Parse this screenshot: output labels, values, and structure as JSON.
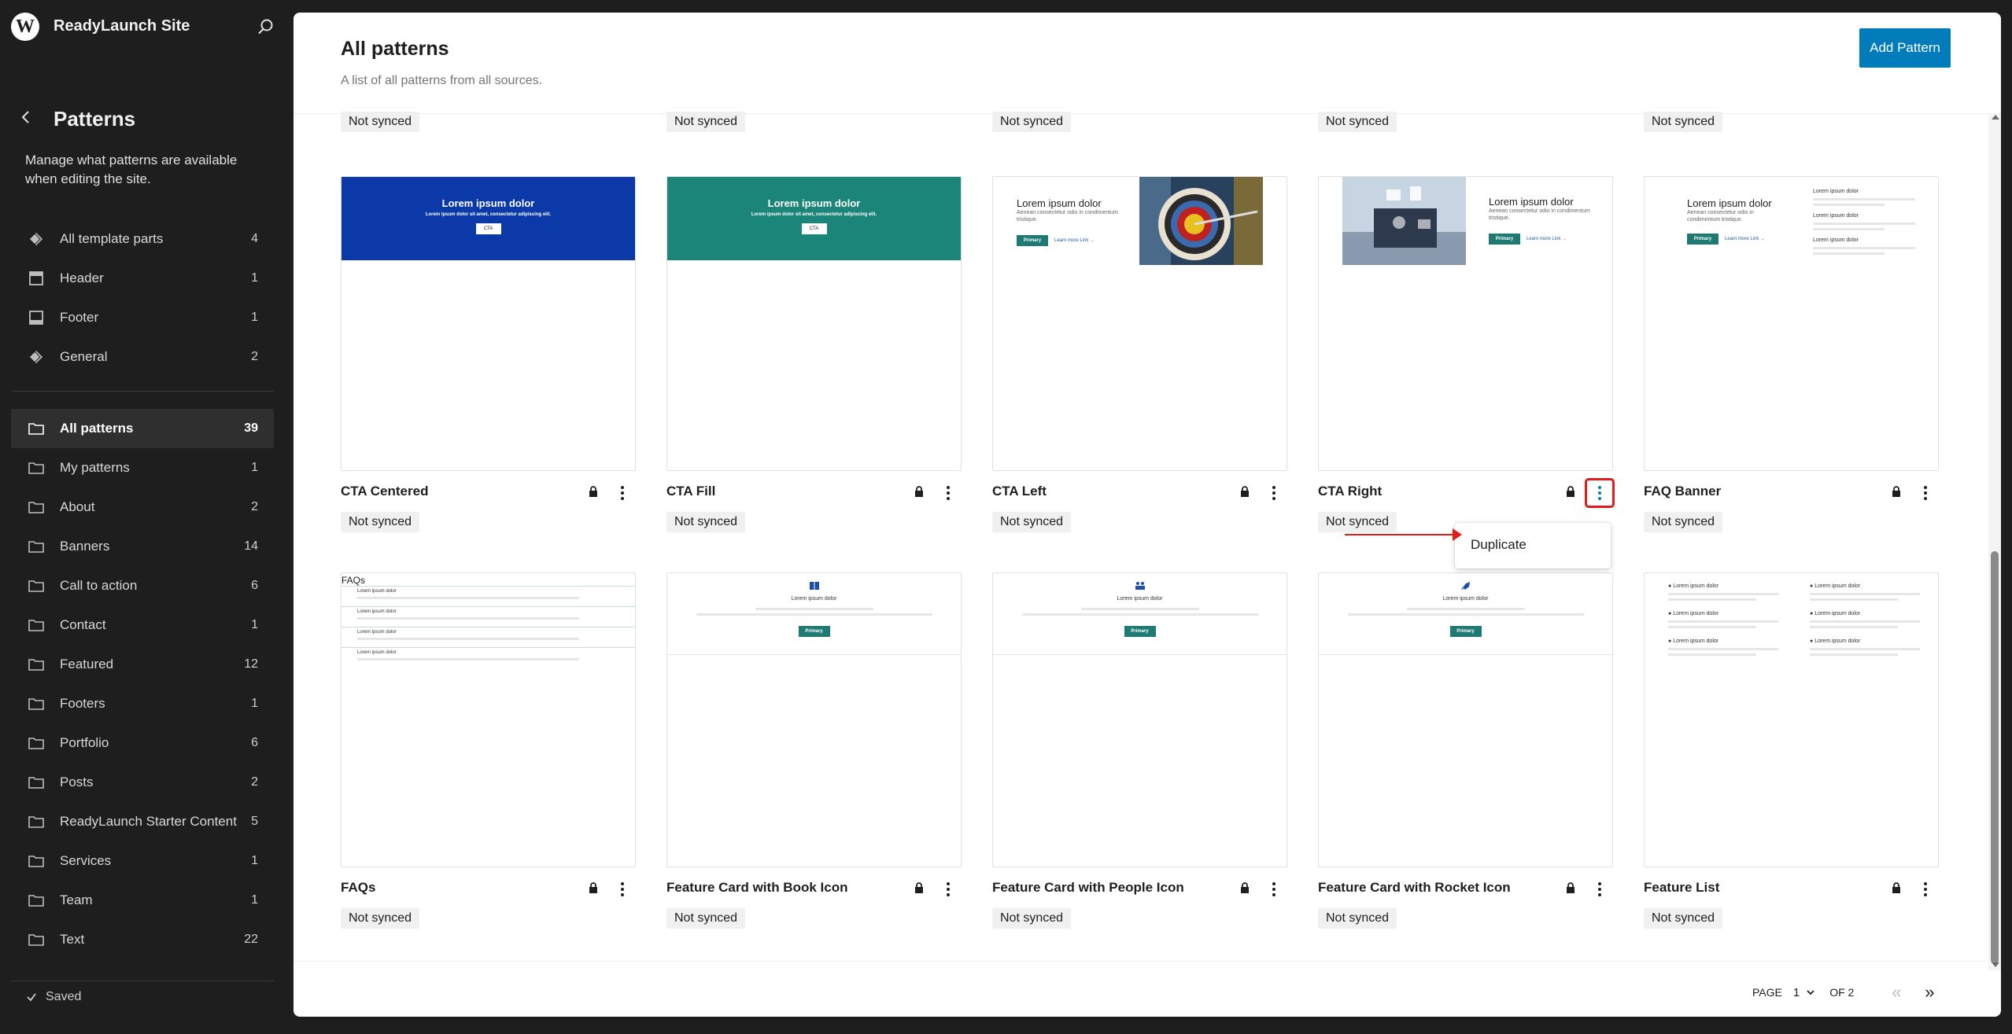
{
  "site": {
    "name": "ReadyLaunch Site"
  },
  "sidebar": {
    "title": "Patterns",
    "description": "Manage what patterns are available when editing the site.",
    "template_parts": [
      {
        "label": "All template parts",
        "count": "4",
        "icon": "diamond-icon"
      },
      {
        "label": "Header",
        "count": "1",
        "icon": "header-icon"
      },
      {
        "label": "Footer",
        "count": "1",
        "icon": "footer-icon"
      },
      {
        "label": "General",
        "count": "2",
        "icon": "diamond-icon"
      }
    ],
    "categories": [
      {
        "label": "All patterns",
        "count": "39"
      },
      {
        "label": "My patterns",
        "count": "1"
      },
      {
        "label": "About",
        "count": "2"
      },
      {
        "label": "Banners",
        "count": "14"
      },
      {
        "label": "Call to action",
        "count": "6"
      },
      {
        "label": "Contact",
        "count": "1"
      },
      {
        "label": "Featured",
        "count": "12"
      },
      {
        "label": "Footers",
        "count": "1"
      },
      {
        "label": "Portfolio",
        "count": "6"
      },
      {
        "label": "Posts",
        "count": "2"
      },
      {
        "label": "ReadyLaunch Starter Content",
        "count": "5"
      },
      {
        "label": "Services",
        "count": "1"
      },
      {
        "label": "Team",
        "count": "1"
      },
      {
        "label": "Text",
        "count": "22"
      }
    ],
    "status": "Saved"
  },
  "main": {
    "title": "All patterns",
    "subtitle": "A list of all patterns from all sources.",
    "add_button": "Add Pattern",
    "sync_label": "Not synced",
    "row1": [
      {
        "title": "CTA Centered"
      },
      {
        "title": "CTA Fill"
      },
      {
        "title": "CTA Left"
      },
      {
        "title": "CTA Right"
      },
      {
        "title": "FAQ Banner"
      }
    ],
    "row2": [
      {
        "title": "FAQs"
      },
      {
        "title": "Feature Card with Book Icon"
      },
      {
        "title": "Feature Card with People Icon"
      },
      {
        "title": "Feature Card with Rocket Icon"
      },
      {
        "title": "Feature List"
      }
    ],
    "thumb_text": {
      "heading": "Lorem ipsum dolor",
      "cta_sub": "Lorem ipsum dolor sit amet, consectetur adipiscing elit.",
      "cta_button": "CTA",
      "left_sub": "Aenean consectetur odio in condimentum tristique.",
      "primary": "Primary",
      "learn_more": "Learn more Link →",
      "faqs_title": "FAQs",
      "faq_item": "Lorem ipsum dolor",
      "small_heading": "Lorem ipsum dolor"
    },
    "dropdown": {
      "item": "Duplicate"
    },
    "pagination": {
      "page_label": "PAGE",
      "current": "1",
      "of_label": "OF 2"
    }
  },
  "colors": {
    "accent": "#007cba",
    "cta_centered": "#0b3aa8",
    "cta_fill": "#1a8578",
    "primary_button": "#1f7a73",
    "annotation": "#e01b1b"
  }
}
